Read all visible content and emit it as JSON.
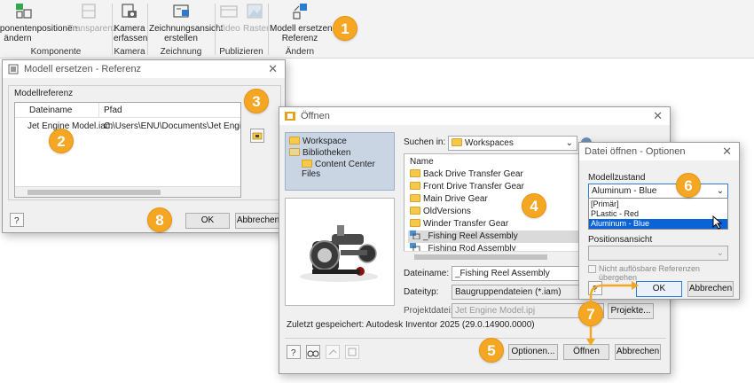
{
  "ribbon": {
    "buttons": {
      "komponentenpositionen": "omponentenpositionen\nändern",
      "transparenz": "Transparenz",
      "kamera": "Kamera\nerfassen",
      "zeichnungsansicht": "Zeichnungsansicht\nerstellen",
      "video": "Video",
      "raster": "Raster",
      "modell_ersetzen": "Modell ersetzen -\nReferenz"
    },
    "groups": {
      "komponente": "Komponente",
      "kamera": "Kamera",
      "zeichnung": "Zeichnung",
      "publizieren": "Publizieren",
      "aendern": "Ändern"
    }
  },
  "callouts": [
    "1",
    "2",
    "3",
    "4",
    "5",
    "6",
    "7",
    "8"
  ],
  "modell_dialog": {
    "title": "Modell ersetzen - Referenz",
    "group_label": "Modellreferenz",
    "col_dateiname": "Dateiname",
    "col_pfad": "Pfad",
    "row_dateiname": "Jet Engine Model.iam",
    "row_pfad": "C:\\Users\\ENU\\Documents\\Jet Engine Model\\Wo",
    "ok": "OK",
    "abbrechen": "Abbrechen"
  },
  "oeffnen_dialog": {
    "title": "Öffnen",
    "tree": [
      "Workspace",
      "Bibliotheken",
      "Content Center Files"
    ],
    "suchen_in_label": "Suchen in:",
    "suchen_in_value": "Workspaces",
    "name_header": "Name",
    "files": [
      "Back Drive Transfer Gear",
      "Front Drive Transfer Gear",
      "Main Drive Gear",
      "OldVersions",
      "Winder Transfer Gear",
      "_Fishing Reel Assembly",
      "_Fishing Rod Assembly"
    ],
    "dateiname_label": "Dateiname:",
    "dateiname_value": "_Fishing Reel Assembly",
    "dateityp_label": "Dateityp:",
    "dateityp_value": "Baugruppendateien (*.iam)",
    "projektdatei_label": "Projektdatei:",
    "projektdatei_value": "Jet Engine Model.ipj",
    "projekte": "Projekte...",
    "zuletzt": "Zuletzt gespeichert: Autodesk Inventor 2025 (29.0.14900.0000)",
    "optionen": "Optionen...",
    "oeffnen": "Öffnen",
    "abbrechen": "Abbrechen"
  },
  "optionen_dialog": {
    "title": "Datei öffnen - Optionen",
    "modellzustand_label": "Modellzustand",
    "modellzustand_value": "Aluminum - Blue",
    "options": [
      "[Primär]",
      "PLastic - Red",
      "Aluminum - Blue"
    ],
    "positionsansicht_label": "Positionsansicht",
    "checkbox_label": "Nicht auflösbare Referenzen übergehen",
    "ok": "OK",
    "abbrechen": "Abbrechen"
  },
  "colors": {
    "callout": "#f5a623",
    "selection": "#0a64d6",
    "folder": "#f6c94a",
    "tree_bg": "#c9d5e3"
  }
}
